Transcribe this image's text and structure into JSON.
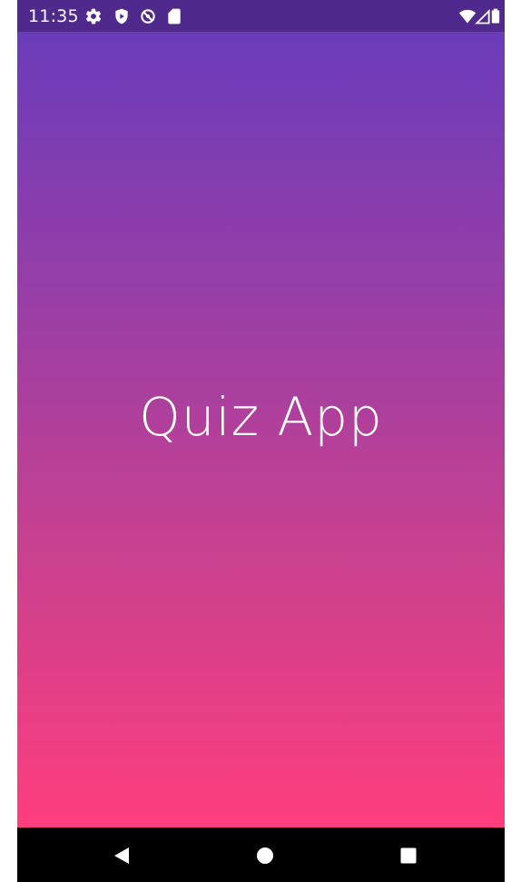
{
  "status_bar": {
    "time": "11:35",
    "background": "#4f2a8c",
    "left_icons": [
      "settings-icon",
      "shield-play-icon",
      "data-saver-icon",
      "sd-card-icon"
    ],
    "right_icons": [
      "wifi-icon",
      "signal-icon",
      "battery-icon"
    ]
  },
  "splash": {
    "title": "Quiz App",
    "gradient_top": "#6a3cba",
    "gradient_bottom": "#ff3d7e"
  },
  "nav_bar": {
    "buttons": [
      "back-icon",
      "home-icon",
      "recents-icon"
    ],
    "background": "#000000"
  }
}
